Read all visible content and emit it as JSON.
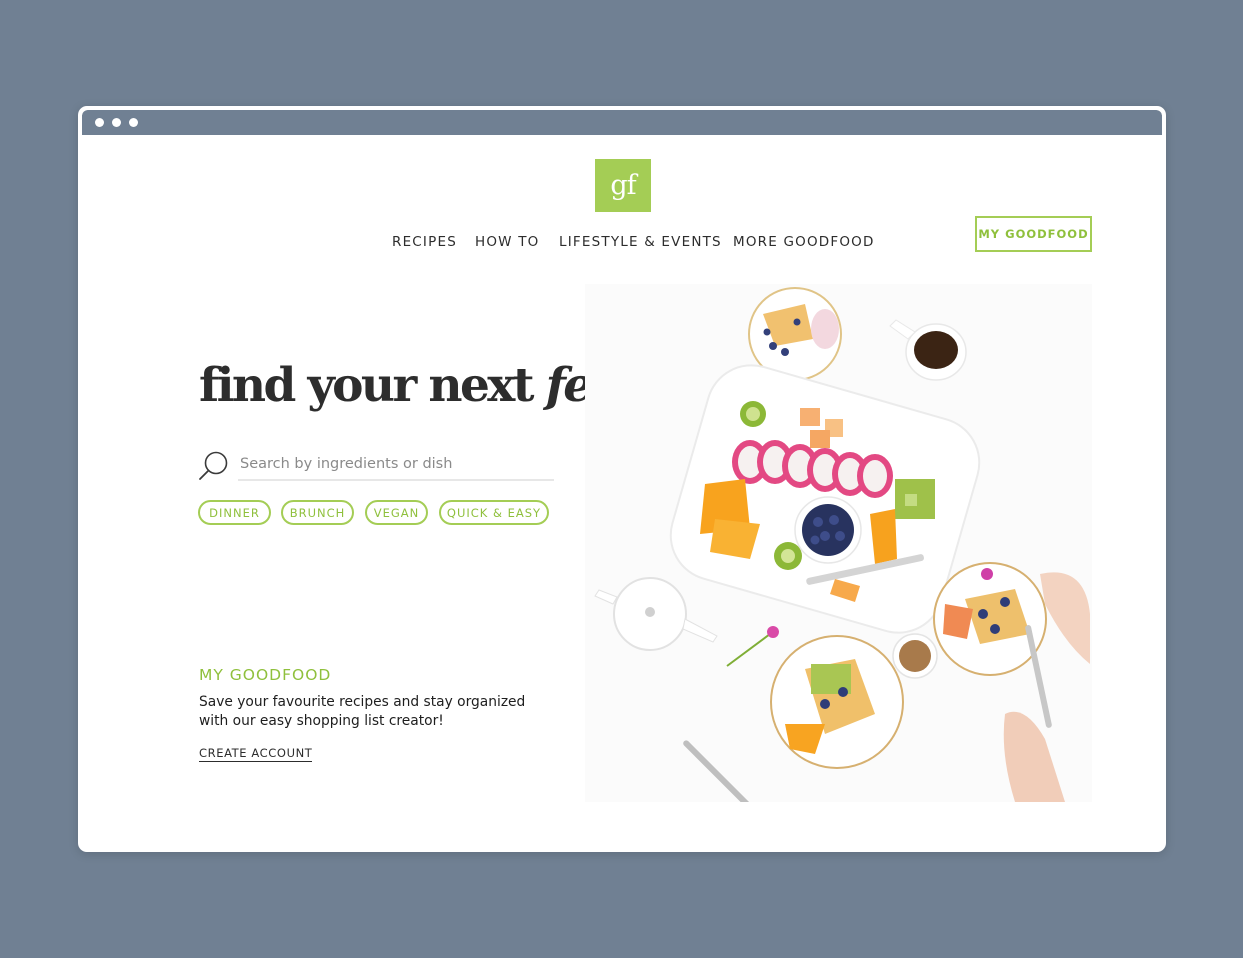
{
  "logo": {
    "text": "gf",
    "color": "#a4cd55"
  },
  "nav": {
    "items": [
      {
        "label": "RECIPES"
      },
      {
        "label": "HOW TO"
      },
      {
        "label": "LIFESTYLE & EVENTS"
      },
      {
        "label": "MORE GOODFOOD"
      }
    ],
    "account_button": "MY GOODFOOD"
  },
  "hero": {
    "title_main": "find your next ",
    "title_emphasis": "feast",
    "image_description": "food-spread-photo"
  },
  "search": {
    "placeholder": "Search by ingredients or dish",
    "icon": "search-icon"
  },
  "tags": [
    {
      "label": "DINNER"
    },
    {
      "label": "BRUNCH"
    },
    {
      "label": "VEGAN"
    },
    {
      "label": "QUICK & EASY"
    }
  ],
  "promo": {
    "title": "MY GOODFOOD",
    "text": "Save your favourite recipes and stay organized with our easy shopping list creator!",
    "link": "CREATE ACCOUNT"
  },
  "colors": {
    "accent": "#a4cd55",
    "accent_text": "#8fc03c",
    "background": "#708093",
    "text": "#2d2d2d"
  }
}
